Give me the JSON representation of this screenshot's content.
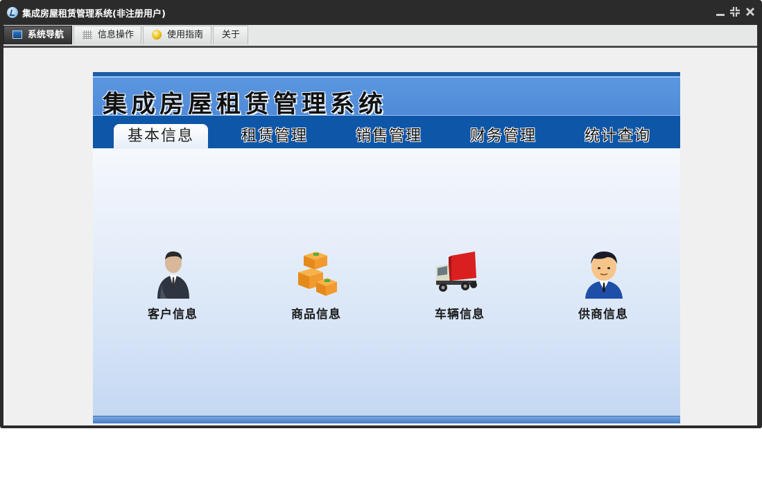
{
  "window": {
    "title": "集成房屋租赁管理系统(非注册用户)"
  },
  "menu": {
    "tabs": [
      {
        "label": "系统导航",
        "icon": "monitor-icon",
        "active": true
      },
      {
        "label": "信息操作",
        "icon": "grid-icon",
        "active": false
      },
      {
        "label": "使用指南",
        "icon": "help-icon",
        "active": false
      },
      {
        "label": "关于",
        "icon": "",
        "active": false
      }
    ]
  },
  "banner": {
    "title": "集成房屋租赁管理系统"
  },
  "nav": {
    "tabs": [
      {
        "label": "基本信息",
        "active": true
      },
      {
        "label": "租赁管理",
        "active": false
      },
      {
        "label": "销售管理",
        "active": false
      },
      {
        "label": "财务管理",
        "active": false
      },
      {
        "label": "统计查询",
        "active": false
      }
    ]
  },
  "modules": [
    {
      "label": "客户信息",
      "icon": "customer-icon"
    },
    {
      "label": "商品信息",
      "icon": "goods-boxes-icon"
    },
    {
      "label": "车辆信息",
      "icon": "truck-icon"
    },
    {
      "label": "供商信息",
      "icon": "supplier-person-icon"
    }
  ],
  "colors": {
    "banner": "#4f8ad8",
    "navbar": "#0e56a7",
    "titlebar": "#2b2b2b"
  }
}
